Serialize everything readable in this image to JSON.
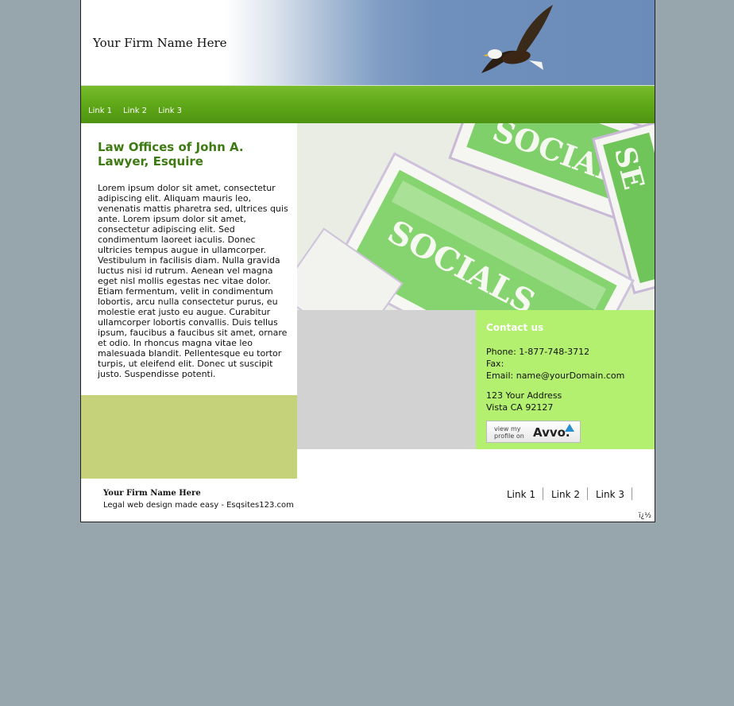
{
  "header": {
    "firm_name": "Your Firm Name Here"
  },
  "nav": {
    "links": [
      "Link 1",
      "Link 2",
      "Link 3"
    ]
  },
  "main": {
    "heading": "Law Offices of John A. Lawyer, Esquire",
    "body": "Lorem ipsum dolor sit amet, consectetur adipiscing elit. Aliquam mauris leo, venenatis mattis pharetra sed, ultrices quis ante. Lorem ipsum dolor sit amet, consectetur adipiscing elit. Sed condimentum laoreet iaculis. Donec ultricies tempus augue in ullamcorper. Vestibulum in facilisis diam. Nulla gravida luctus nisi id rutrum. Aenean vel magna eget nisl mollis egestas nec vitae dolor. Etiam fermentum, velit in condimentum lobortis, arcu nulla consectetur purus, eu molestie erat justo eu augue. Curabitur ullamcorper lobortis convallis. Duis tellus ipsum, faucibus a faucibus sit amet, ornare et odio. In rhoncus magna vitae leo malesuada blandit. Pellentesque eu tortor turpis, ut eleifend elit. Donec ut suscipit justo. Suspendisse potenti."
  },
  "hero": {
    "text_large": "SOCIALS",
    "text_top": "SOCIALS",
    "text_right": "SE"
  },
  "contact": {
    "title": "Contact us",
    "phone": "Phone: 1-877-748-3712",
    "fax": "Fax:",
    "email": "Email: name@yourDomain.com",
    "address1": "123 Your Address",
    "address2": "Vista CA 92127",
    "avvo_small": "view my profile on",
    "avvo_logo": "Avvo."
  },
  "footer": {
    "firm_name": "Your Firm Name Here",
    "tagline": "Legal web design made easy - Esqsites123.com",
    "links": [
      "Link 1",
      "Link 2",
      "Link 3"
    ],
    "corner_mark": "ï¿½"
  },
  "colors": {
    "background": "#97a6ad",
    "nav_green": "#5fa818",
    "heading_green": "#3d7a12",
    "contact_green": "#b4f070",
    "olive_box": "#c5d27a",
    "gray_box": "#d2d2d2"
  }
}
